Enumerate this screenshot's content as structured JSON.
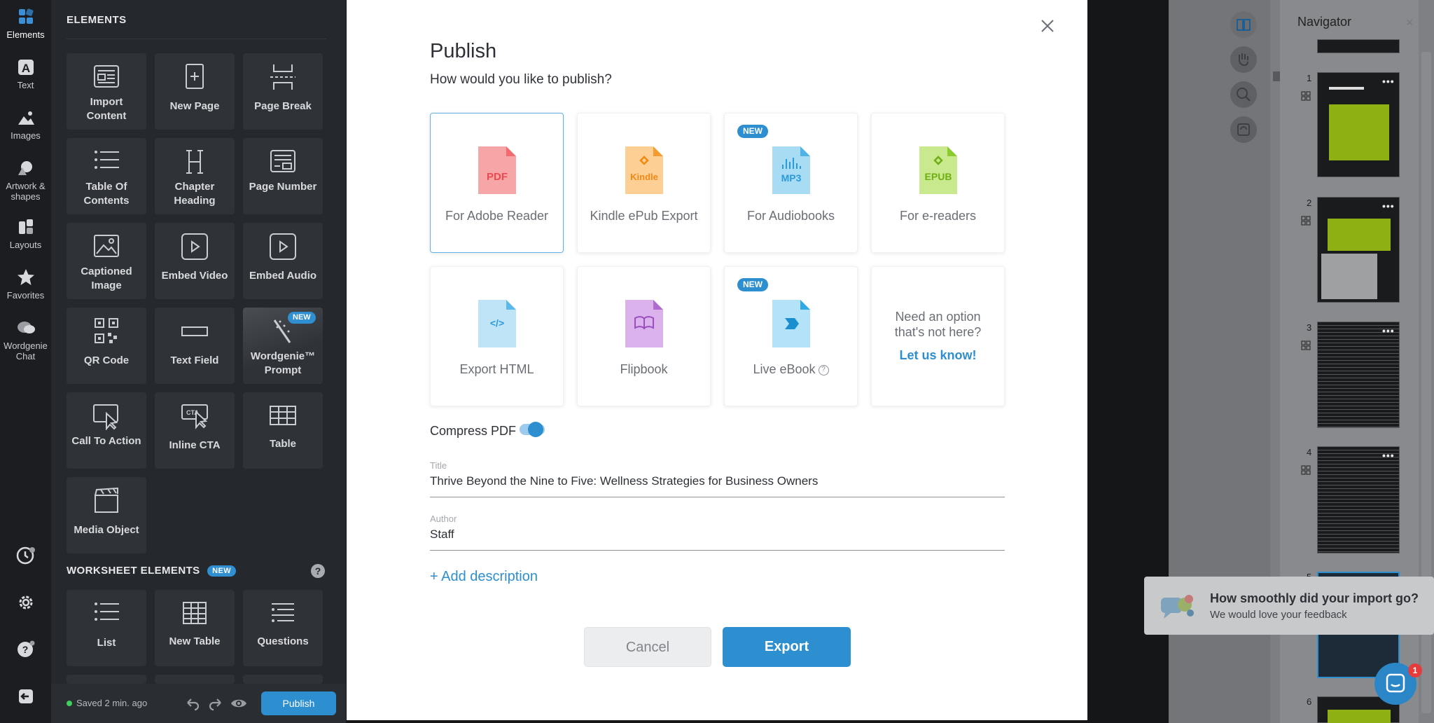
{
  "rail": {
    "items": [
      {
        "label": "Elements"
      },
      {
        "label": "Text"
      },
      {
        "label": "Images"
      },
      {
        "label": "Artwork & shapes"
      },
      {
        "label": "Layouts"
      },
      {
        "label": "Favorites"
      },
      {
        "label": "Wordgenie Chat"
      }
    ]
  },
  "panel": {
    "title": "ELEMENTS",
    "tiles": [
      {
        "label": "Import Content",
        "icon": "import-content-icon"
      },
      {
        "label": "New Page",
        "icon": "new-page-icon"
      },
      {
        "label": "Page Break",
        "icon": "page-break-icon"
      },
      {
        "label": "Table Of Contents",
        "icon": "table-of-contents-icon"
      },
      {
        "label": "Chapter Heading",
        "icon": "chapter-heading-icon"
      },
      {
        "label": "Page Number",
        "icon": "page-number-icon"
      },
      {
        "label": "Captioned Image",
        "icon": "captioned-image-icon"
      },
      {
        "label": "Embed Video",
        "icon": "embed-video-icon"
      },
      {
        "label": "Embed Audio",
        "icon": "embed-audio-icon"
      },
      {
        "label": "QR Code",
        "icon": "qr-code-icon"
      },
      {
        "label": "Text Field",
        "icon": "text-field-icon"
      },
      {
        "label": "Wordgenie™ Prompt",
        "icon": "wand-icon",
        "badge": "NEW"
      },
      {
        "label": "Call To Action",
        "icon": "call-to-action-icon"
      },
      {
        "label": "Inline CTA",
        "icon": "inline-cta-icon"
      },
      {
        "label": "Table",
        "icon": "table-icon"
      },
      {
        "label": "Media Object",
        "icon": "media-object-icon"
      }
    ],
    "worksheet_title": "WORKSHEET ELEMENTS",
    "worksheet_badge": "NEW",
    "help": "?",
    "worksheet_tiles": [
      {
        "label": "List",
        "icon": "list-icon"
      },
      {
        "label": "New Table",
        "icon": "new-table-icon"
      },
      {
        "label": "Questions",
        "icon": "questions-icon"
      }
    ],
    "footer": {
      "saved": "Saved 2 min. ago",
      "publish": "Publish"
    }
  },
  "modal": {
    "title": "Publish",
    "subtitle": "How would you like to publish?",
    "options": [
      {
        "label": "For Adobe Reader",
        "badge": "",
        "icon_text": "PDF",
        "color": "#f36b6f"
      },
      {
        "label": "Kindle ePub Export",
        "badge": "",
        "icon_text": "Kindle",
        "color": "#f59a2e"
      },
      {
        "label": "For Audiobooks",
        "badge": "NEW",
        "icon_text": "MP3",
        "color": "#4fb3e6"
      },
      {
        "label": "For e-readers",
        "badge": "",
        "icon_text": "EPUB",
        "color": "#8ccb2d"
      },
      {
        "label": "Export HTML",
        "badge": "",
        "icon_text": "</>",
        "color": "#5cb9ea"
      },
      {
        "label": "Flipbook",
        "badge": "",
        "icon_text": "",
        "color": "#b06bd0"
      },
      {
        "label": "Live eBook",
        "badge": "NEW",
        "icon_text": "",
        "color": "#30a9e4"
      }
    ],
    "need_option": "Need an option that's not here?",
    "let_us_know": "Let us know!",
    "compress_label": "Compress PDF",
    "compress_on": true,
    "title_label": "Title",
    "title_value": "Thrive Beyond the Nine to Five: Wellness Strategies for Business Owners",
    "author_label": "Author",
    "author_value": "Staff",
    "add_description": "+ Add description",
    "cancel": "Cancel",
    "export": "Export"
  },
  "navigator": {
    "title": "Navigator",
    "pages": [
      "1",
      "2",
      "3",
      "4",
      "5",
      "6"
    ]
  },
  "toast": {
    "title": "How smoothly did your import go?",
    "subtitle": "We would love your feedback"
  },
  "chat": {
    "badge": "1"
  }
}
